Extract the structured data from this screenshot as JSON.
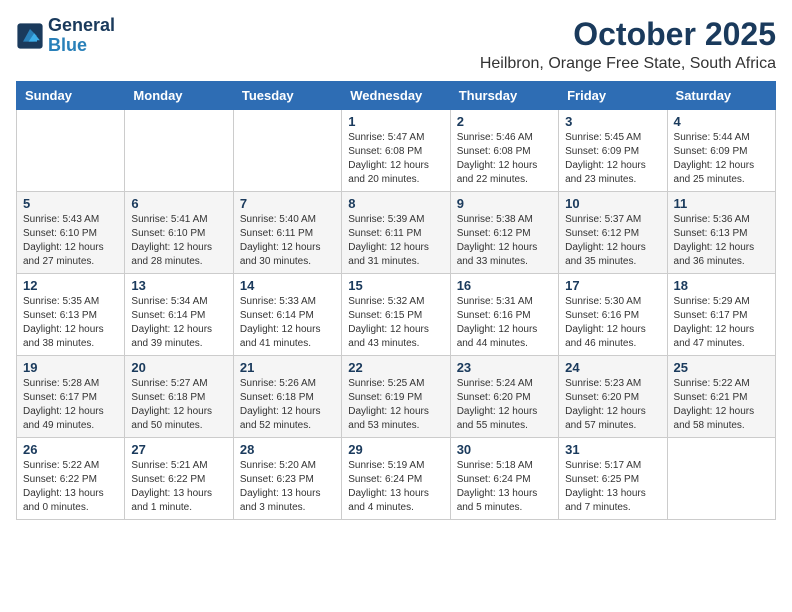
{
  "header": {
    "logo_line1": "General",
    "logo_line2": "Blue",
    "month_title": "October 2025",
    "location": "Heilbron, Orange Free State, South Africa"
  },
  "weekdays": [
    "Sunday",
    "Monday",
    "Tuesday",
    "Wednesday",
    "Thursday",
    "Friday",
    "Saturday"
  ],
  "weeks": [
    [
      {
        "day": "",
        "content": ""
      },
      {
        "day": "",
        "content": ""
      },
      {
        "day": "",
        "content": ""
      },
      {
        "day": "1",
        "content": "Sunrise: 5:47 AM\nSunset: 6:08 PM\nDaylight: 12 hours\nand 20 minutes."
      },
      {
        "day": "2",
        "content": "Sunrise: 5:46 AM\nSunset: 6:08 PM\nDaylight: 12 hours\nand 22 minutes."
      },
      {
        "day": "3",
        "content": "Sunrise: 5:45 AM\nSunset: 6:09 PM\nDaylight: 12 hours\nand 23 minutes."
      },
      {
        "day": "4",
        "content": "Sunrise: 5:44 AM\nSunset: 6:09 PM\nDaylight: 12 hours\nand 25 minutes."
      }
    ],
    [
      {
        "day": "5",
        "content": "Sunrise: 5:43 AM\nSunset: 6:10 PM\nDaylight: 12 hours\nand 27 minutes."
      },
      {
        "day": "6",
        "content": "Sunrise: 5:41 AM\nSunset: 6:10 PM\nDaylight: 12 hours\nand 28 minutes."
      },
      {
        "day": "7",
        "content": "Sunrise: 5:40 AM\nSunset: 6:11 PM\nDaylight: 12 hours\nand 30 minutes."
      },
      {
        "day": "8",
        "content": "Sunrise: 5:39 AM\nSunset: 6:11 PM\nDaylight: 12 hours\nand 31 minutes."
      },
      {
        "day": "9",
        "content": "Sunrise: 5:38 AM\nSunset: 6:12 PM\nDaylight: 12 hours\nand 33 minutes."
      },
      {
        "day": "10",
        "content": "Sunrise: 5:37 AM\nSunset: 6:12 PM\nDaylight: 12 hours\nand 35 minutes."
      },
      {
        "day": "11",
        "content": "Sunrise: 5:36 AM\nSunset: 6:13 PM\nDaylight: 12 hours\nand 36 minutes."
      }
    ],
    [
      {
        "day": "12",
        "content": "Sunrise: 5:35 AM\nSunset: 6:13 PM\nDaylight: 12 hours\nand 38 minutes."
      },
      {
        "day": "13",
        "content": "Sunrise: 5:34 AM\nSunset: 6:14 PM\nDaylight: 12 hours\nand 39 minutes."
      },
      {
        "day": "14",
        "content": "Sunrise: 5:33 AM\nSunset: 6:14 PM\nDaylight: 12 hours\nand 41 minutes."
      },
      {
        "day": "15",
        "content": "Sunrise: 5:32 AM\nSunset: 6:15 PM\nDaylight: 12 hours\nand 43 minutes."
      },
      {
        "day": "16",
        "content": "Sunrise: 5:31 AM\nSunset: 6:16 PM\nDaylight: 12 hours\nand 44 minutes."
      },
      {
        "day": "17",
        "content": "Sunrise: 5:30 AM\nSunset: 6:16 PM\nDaylight: 12 hours\nand 46 minutes."
      },
      {
        "day": "18",
        "content": "Sunrise: 5:29 AM\nSunset: 6:17 PM\nDaylight: 12 hours\nand 47 minutes."
      }
    ],
    [
      {
        "day": "19",
        "content": "Sunrise: 5:28 AM\nSunset: 6:17 PM\nDaylight: 12 hours\nand 49 minutes."
      },
      {
        "day": "20",
        "content": "Sunrise: 5:27 AM\nSunset: 6:18 PM\nDaylight: 12 hours\nand 50 minutes."
      },
      {
        "day": "21",
        "content": "Sunrise: 5:26 AM\nSunset: 6:18 PM\nDaylight: 12 hours\nand 52 minutes."
      },
      {
        "day": "22",
        "content": "Sunrise: 5:25 AM\nSunset: 6:19 PM\nDaylight: 12 hours\nand 53 minutes."
      },
      {
        "day": "23",
        "content": "Sunrise: 5:24 AM\nSunset: 6:20 PM\nDaylight: 12 hours\nand 55 minutes."
      },
      {
        "day": "24",
        "content": "Sunrise: 5:23 AM\nSunset: 6:20 PM\nDaylight: 12 hours\nand 57 minutes."
      },
      {
        "day": "25",
        "content": "Sunrise: 5:22 AM\nSunset: 6:21 PM\nDaylight: 12 hours\nand 58 minutes."
      }
    ],
    [
      {
        "day": "26",
        "content": "Sunrise: 5:22 AM\nSunset: 6:22 PM\nDaylight: 13 hours\nand 0 minutes."
      },
      {
        "day": "27",
        "content": "Sunrise: 5:21 AM\nSunset: 6:22 PM\nDaylight: 13 hours\nand 1 minute."
      },
      {
        "day": "28",
        "content": "Sunrise: 5:20 AM\nSunset: 6:23 PM\nDaylight: 13 hours\nand 3 minutes."
      },
      {
        "day": "29",
        "content": "Sunrise: 5:19 AM\nSunset: 6:24 PM\nDaylight: 13 hours\nand 4 minutes."
      },
      {
        "day": "30",
        "content": "Sunrise: 5:18 AM\nSunset: 6:24 PM\nDaylight: 13 hours\nand 5 minutes."
      },
      {
        "day": "31",
        "content": "Sunrise: 5:17 AM\nSunset: 6:25 PM\nDaylight: 13 hours\nand 7 minutes."
      },
      {
        "day": "",
        "content": ""
      }
    ]
  ]
}
